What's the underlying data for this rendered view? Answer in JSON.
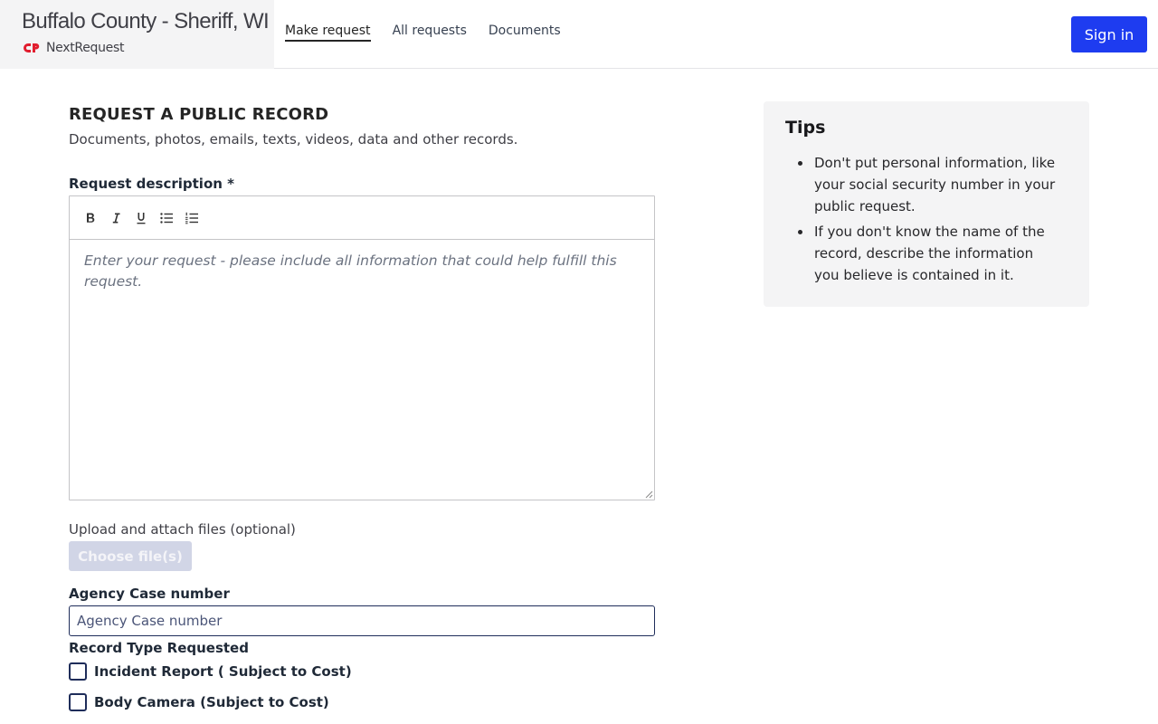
{
  "header": {
    "title": "Buffalo County - Sheriff, WI",
    "brand_name": "NextRequest",
    "brand_color": "#e11d2e",
    "nav": [
      {
        "label": "Make request",
        "active": true
      },
      {
        "label": "All requests",
        "active": false
      },
      {
        "label": "Documents",
        "active": false
      }
    ],
    "sign_in_label": "Sign in",
    "accent_color": "#1e3cf0"
  },
  "form": {
    "heading": "REQUEST A PUBLIC RECORD",
    "subheading": "Documents, photos, emails, texts, videos, data and other records.",
    "description_label": "Request description",
    "required_mark": "*",
    "toolbar": [
      {
        "icon": "bold-icon",
        "glyph": "B"
      },
      {
        "icon": "italic-icon",
        "glyph": "I"
      },
      {
        "icon": "underline-icon",
        "glyph": "U"
      },
      {
        "icon": "bullet-list-icon",
        "glyph": ""
      },
      {
        "icon": "numbered-list-icon",
        "glyph": ""
      }
    ],
    "description_placeholder": "Enter your request - please include all information that could help fulfill this request.",
    "upload_label": "Upload and attach files (optional)",
    "choose_files_label": "Choose file(s)",
    "case_number_label": "Agency Case number",
    "case_number_placeholder": "Agency Case number",
    "case_number_value": "",
    "record_type_label": "Record Type Requested",
    "record_types": [
      {
        "label": "Incident Report ( Subject to Cost)",
        "checked": false
      },
      {
        "label": "Body Camera (Subject to Cost)",
        "checked": false
      }
    ]
  },
  "tips": {
    "title": "Tips",
    "items": [
      "Don't put personal information, like your social security number in your public request.",
      "If you don't know the name of the record, describe the information you believe is contained in it."
    ]
  }
}
